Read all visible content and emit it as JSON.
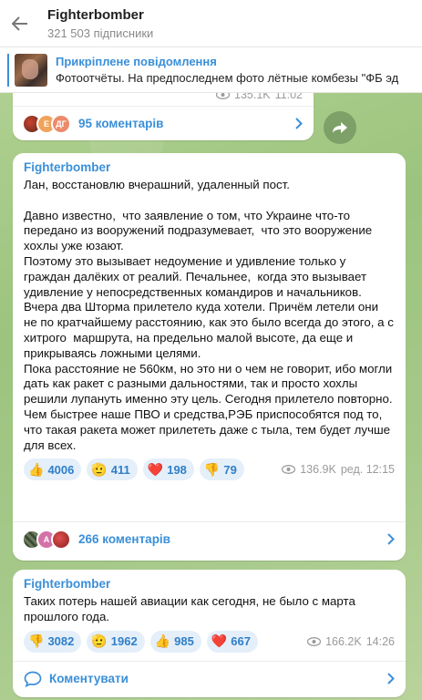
{
  "header": {
    "title": "Fighterbomber",
    "subscribers": "321 503 підписники"
  },
  "pinned": {
    "label": "Прикріплене повідомлення",
    "text": "Фотоотчёты.   На предпоследнем фото лётные комбезы \"ФБ эд"
  },
  "post0": {
    "views": "135.1K",
    "time": "11:02",
    "avatar_labels": [
      "",
      "Е",
      "ДГ"
    ],
    "comments_label": "95 коментарів"
  },
  "post1": {
    "author": "Fighterbomber",
    "text": "Лан, восстановлю вчерашний, удаленный пост.\n\nДавно известно,  что заявление о том, что Украине что-то передано из вооружений подразумевает,  что это вооружение хохлы уже юзают.\nПоэтому это вызывает недоумение и удивление только у граждан далёких от реалий. Печальнее,  когда это вызывает удивление у непосредственных командиров и начальников.\nВчера два Шторма прилетело куда хотели. Причём летели они не по кратчайшему расстоянию, как это было всегда до этого, а с хитрого  маршрута, на предельно малой высоте, да еще и прикрываясь ложными целями.\nПока расстояние не 560км, но это ни о чем не говорит, ибо могли дать как ракет с разными дальностями, так и просто хохлы решили лупануть именно эту цель. Сегодня прилетело повторно.\nЧем быстрее наше ПВО и средства,РЭБ приспособятся под то, что такая ракета может прилететь даже с тыла, тем будет лучше для всех.",
    "reactions": [
      {
        "emoji": "👍",
        "count": "4006"
      },
      {
        "emoji": "🫡",
        "count": "411"
      },
      {
        "emoji": "❤️",
        "count": "198"
      },
      {
        "emoji": "👎",
        "count": "79"
      }
    ],
    "views": "136.9K",
    "edited_time": "ред. 12:15",
    "avatar_labels": [
      "",
      "А",
      ""
    ],
    "comments_label": "266 коментарів"
  },
  "post2": {
    "author": "Fighterbomber",
    "text": "Таких потерь нашей авиации как сегодня, не было с марта прошлого года.",
    "reactions": [
      {
        "emoji": "👎",
        "count": "3082"
      },
      {
        "emoji": "🫡",
        "count": "1962"
      },
      {
        "emoji": "👍",
        "count": "985"
      },
      {
        "emoji": "❤️",
        "count": "667"
      }
    ],
    "views": "166.2K",
    "time": "14:26",
    "comment_action": "Коментувати"
  },
  "colors": {
    "accent": "#3a8fd8",
    "reaction_bg": "#e4effa",
    "chat_bg": "#a9c98c"
  }
}
